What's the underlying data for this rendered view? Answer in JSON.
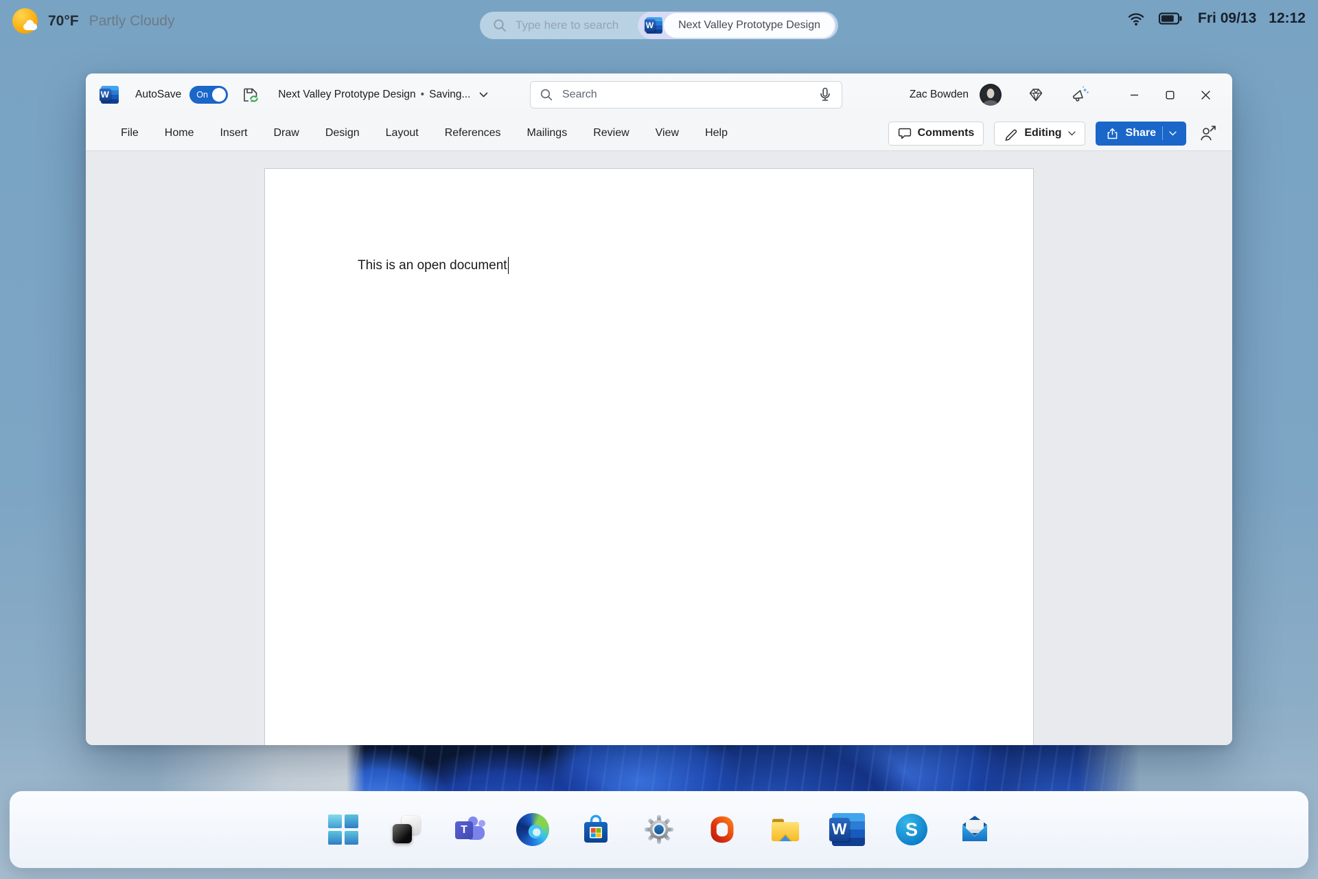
{
  "desktop": {
    "weather": {
      "temperature": "70°F",
      "condition": "Partly Cloudy"
    },
    "search": {
      "placeholder": "Type here to search",
      "active_app": "Next Valley Prototype Design"
    },
    "tray": {
      "date": "Fri 09/13",
      "time": "12:12"
    }
  },
  "word": {
    "titlebar": {
      "autosave_label": "AutoSave",
      "autosave_state": "On",
      "title": "Next Valley Prototype Design",
      "separator": "•",
      "status": "Saving...",
      "search_placeholder": "Search",
      "user": "Zac Bowden"
    },
    "ribbon": {
      "tabs": [
        "File",
        "Home",
        "Insert",
        "Draw",
        "Design",
        "Layout",
        "References",
        "Mailings",
        "Review",
        "View",
        "Help"
      ],
      "comments": "Comments",
      "editing": "Editing",
      "share": "Share"
    },
    "document": {
      "text": "This is an open document"
    }
  },
  "logos": {
    "word": "W",
    "teams": "T",
    "skype": "S"
  },
  "taskbar": {
    "items": [
      "start",
      "task-view",
      "teams",
      "edge",
      "microsoft-store",
      "settings",
      "office",
      "file-explorer",
      "word",
      "skype",
      "mail"
    ]
  },
  "colors": {
    "accent_blue": "#1a66c9",
    "desktop_blue": "#7aa3c2",
    "taskbar_bg": "#f7fafd",
    "bloom_navy": "#0a1430"
  }
}
